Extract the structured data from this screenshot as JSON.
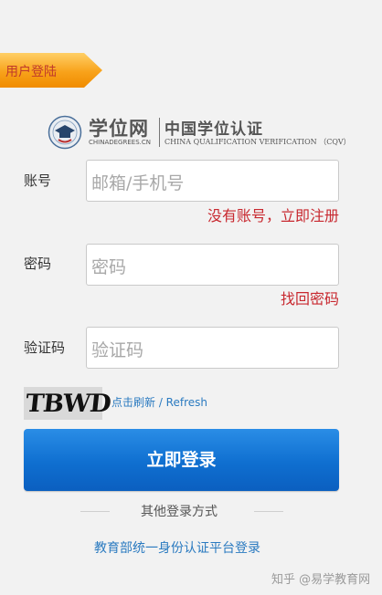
{
  "header": {
    "title": "用户登陆"
  },
  "logo": {
    "cn_main": "学位网",
    "en_main": "CHINADEGREES.CN",
    "cn_sub": "中国学位认证",
    "en_sub": "CHINA QUALIFICATION VERIFICATION （CQV）"
  },
  "form": {
    "account": {
      "label": "账号",
      "placeholder": "邮箱/手机号",
      "register_link": "没有账号，立即注册"
    },
    "password": {
      "label": "密码",
      "placeholder": "密码",
      "forgot_link": "找回密码"
    },
    "captcha": {
      "label": "验证码",
      "placeholder": "验证码",
      "image_text": "TBWD",
      "refresh_label": "点击刷新 / Refresh"
    },
    "submit_label": "立即登录"
  },
  "alt_login": {
    "divider_text": "其他登录方式",
    "unified_login": "教育部统一身份认证平台登录"
  },
  "watermark": "知乎 @易学教育网",
  "colors": {
    "accent": "#1172d6",
    "link": "#2a7ac0",
    "error": "#c8282f",
    "ribbon": "#f8a21a"
  }
}
